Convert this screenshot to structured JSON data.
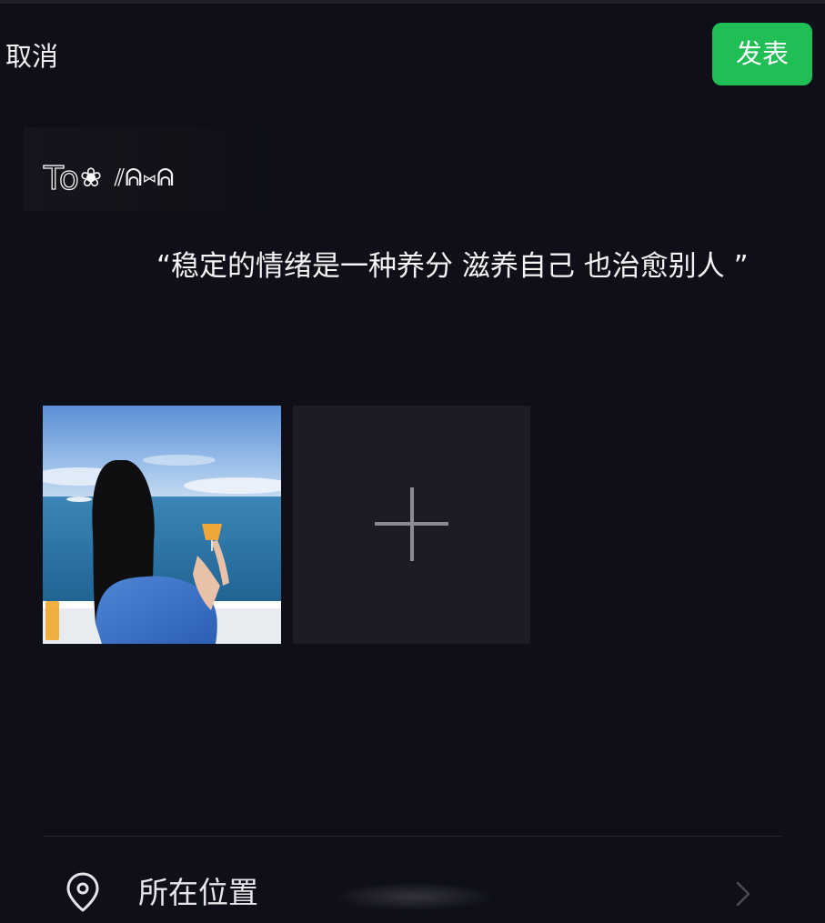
{
  "header": {
    "cancel_label": "取消",
    "publish_label": "发表",
    "publish_color": "#1fbf55"
  },
  "post": {
    "title_outline": "To",
    "title_flower": "❀",
    "title_kaomoji": "⫽ᕱ⑅ᕱ",
    "body": "“稳定的情绪是一种养分 滋养自己 也治愈别人 ”"
  },
  "media": {
    "photo_icon": "photo-thumbnail",
    "add_icon": "plus-icon"
  },
  "location": {
    "label": "所在位置",
    "icon": "location-pin-icon",
    "chevron": "chevron-right-icon"
  },
  "colors": {
    "background": "#0e0f18",
    "tile": "#1b1c25",
    "text": "#f4f4f4"
  }
}
